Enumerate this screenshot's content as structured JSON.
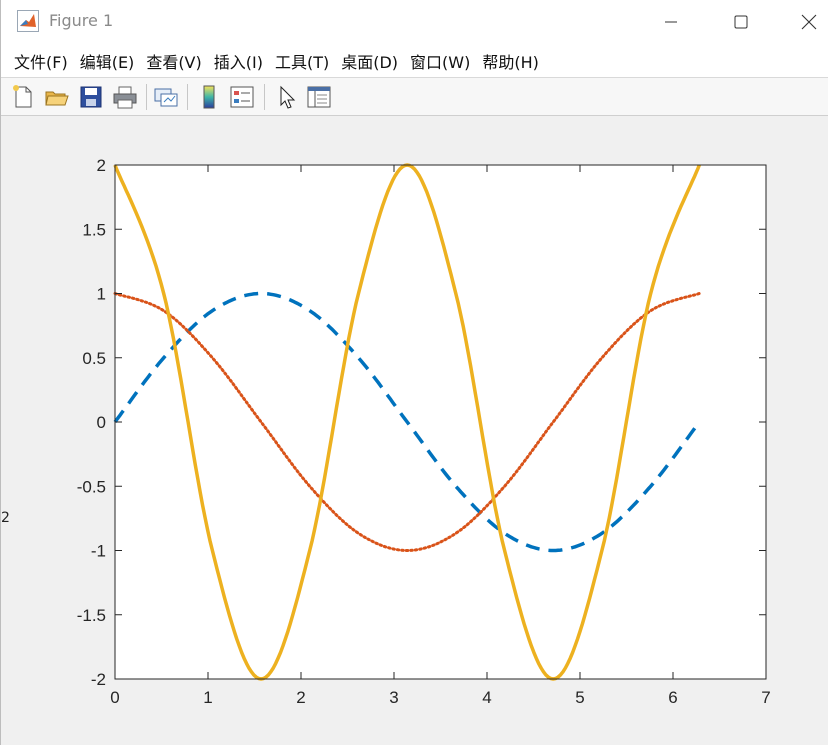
{
  "window": {
    "title": "Figure 1",
    "minimize_icon": "minimize-icon",
    "maximize_icon": "maximize-icon",
    "close_icon": "close-icon",
    "app_icon": "matlab-logo-icon"
  },
  "menu": {
    "items": [
      {
        "label": "文件(F)"
      },
      {
        "label": "编辑(E)"
      },
      {
        "label": "查看(V)"
      },
      {
        "label": "插入(I)"
      },
      {
        "label": "工具(T)"
      },
      {
        "label": "桌面(D)"
      },
      {
        "label": "窗口(W)"
      },
      {
        "label": "帮助(H)"
      }
    ]
  },
  "toolbar": {
    "tools": [
      {
        "icon": "new-figure-icon"
      },
      {
        "icon": "open-file-icon"
      },
      {
        "icon": "save-icon"
      },
      {
        "icon": "print-icon"
      },
      {
        "icon": "link-plot-icon"
      },
      {
        "icon": "insert-colorbar-icon"
      },
      {
        "icon": "insert-legend-icon"
      },
      {
        "icon": "edit-plot-pointer-icon"
      },
      {
        "icon": "property-inspector-icon"
      }
    ]
  },
  "background": {
    "peek_text": "2"
  },
  "chart_data": {
    "type": "line",
    "title": "",
    "xlabel": "",
    "ylabel": "",
    "xlim": [
      0,
      7
    ],
    "ylim": [
      -2,
      2
    ],
    "xticks": [
      0,
      1,
      2,
      3,
      4,
      5,
      6,
      7
    ],
    "yticks": [
      -2,
      -1.5,
      -1,
      -0.5,
      0,
      0.5,
      1,
      1.5,
      2
    ],
    "xtick_labels": [
      "0",
      "1",
      "2",
      "3",
      "4",
      "5",
      "6",
      "7"
    ],
    "ytick_labels": [
      "-2",
      "-1.5",
      "-1",
      "-0.5",
      "0",
      "0.5",
      "1",
      "1.5",
      "2"
    ],
    "grid": false,
    "legend": "none",
    "series": [
      {
        "style": "dashed",
        "color": "#0072BD",
        "x": [
          0,
          0.524,
          1.047,
          1.571,
          2.094,
          2.618,
          3.142,
          3.665,
          4.189,
          4.712,
          5.236,
          5.76,
          6.283
        ],
        "y": [
          0,
          0.5,
          0.866,
          1,
          0.866,
          0.5,
          0,
          -0.5,
          -0.866,
          -1,
          -0.866,
          -0.5,
          0
        ]
      },
      {
        "style": "dotted",
        "color": "#D95319",
        "x": [
          0,
          0.524,
          1.047,
          1.571,
          2.094,
          2.618,
          3.142,
          3.665,
          4.189,
          4.712,
          5.236,
          5.76,
          6.283
        ],
        "y": [
          1,
          0.866,
          0.5,
          0,
          -0.5,
          -0.866,
          -1,
          -0.866,
          -0.5,
          0,
          0.5,
          0.866,
          1
        ]
      },
      {
        "style": "solid",
        "color": "#EDB120",
        "x": [
          0,
          0.524,
          1.047,
          1.571,
          2.094,
          2.618,
          3.142,
          3.665,
          4.189,
          4.712,
          5.236,
          5.76,
          6.283
        ],
        "y": [
          2,
          1,
          -1,
          -2,
          -1,
          1,
          2,
          1,
          -1,
          -2,
          -1,
          1,
          2
        ]
      }
    ]
  }
}
